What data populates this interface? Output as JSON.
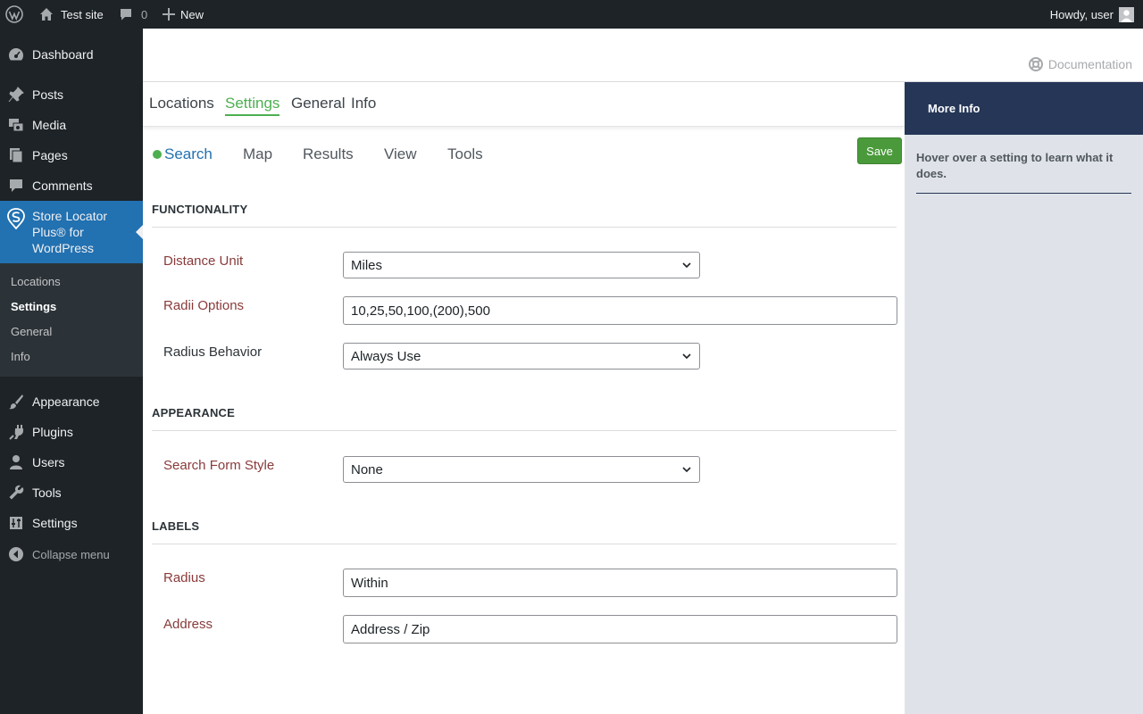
{
  "adminbar": {
    "site_name": "Test site",
    "comments_count": "0",
    "new_label": "New",
    "howdy": "Howdy, user"
  },
  "sidebar": {
    "items": [
      {
        "label": "Dashboard",
        "icon": "dashboard-icon"
      },
      {
        "label": "Posts",
        "icon": "pin-icon"
      },
      {
        "label": "Media",
        "icon": "media-icon"
      },
      {
        "label": "Pages",
        "icon": "pages-icon"
      },
      {
        "label": "Comments",
        "icon": "comment-icon"
      },
      {
        "label": "Store Locator Plus® for WordPress",
        "icon": "store-locator-icon"
      },
      {
        "label": "Appearance",
        "icon": "brush-icon"
      },
      {
        "label": "Plugins",
        "icon": "plugin-icon"
      },
      {
        "label": "Users",
        "icon": "user-icon"
      },
      {
        "label": "Tools",
        "icon": "wrench-icon"
      },
      {
        "label": "Settings",
        "icon": "sliders-icon"
      }
    ],
    "submenu": [
      "Locations",
      "Settings",
      "General",
      "Info"
    ],
    "current_submenu": "Settings",
    "collapse_label": "Collapse menu"
  },
  "header": {
    "documentation_label": "Documentation"
  },
  "primary_tabs": [
    "Locations",
    "Settings",
    "General",
    "Info"
  ],
  "active_primary_tab": "Settings",
  "sub_tabs": [
    "Search",
    "Map",
    "Results",
    "View",
    "Tools"
  ],
  "active_sub_tab": "Search",
  "save_label": "Save",
  "sections": {
    "functionality": {
      "title": "FUNCTIONALITY",
      "distance_unit_label": "Distance Unit",
      "distance_unit_value": "Miles",
      "radii_options_label": "Radii Options",
      "radii_options_value": "10,25,50,100,(200),500",
      "radius_behavior_label": "Radius Behavior",
      "radius_behavior_value": "Always Use"
    },
    "appearance": {
      "title": "APPEARANCE",
      "search_form_style_label": "Search Form Style",
      "search_form_style_value": "None"
    },
    "labels": {
      "title": "LABELS",
      "radius_label": "Radius",
      "radius_value": "Within",
      "address_label": "Address",
      "address_value": "Address / Zip"
    }
  },
  "info_panel": {
    "title": "More Info",
    "text": "Hover over a setting to learn what it does."
  },
  "colors": {
    "admin_dark": "#1d2327",
    "wp_blue": "#2271b1",
    "accent_green": "#4caf50",
    "save_green": "#4a9a3b",
    "label_red": "#8a3a3a",
    "info_navy": "#253657",
    "info_bg": "#dfe3e9"
  }
}
